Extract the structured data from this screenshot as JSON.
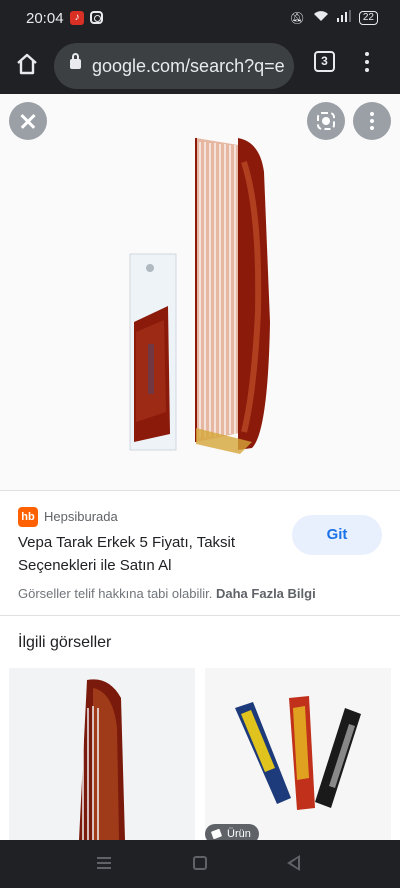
{
  "status_bar": {
    "time": "20:04",
    "battery": "22"
  },
  "browser": {
    "url": "google.com/search?q=e",
    "tab_count": "3"
  },
  "viewer": {
    "source_logo_text": "hb",
    "source_name": "Hepsiburada",
    "title": "Vepa Tarak Erkek 5 Fiyatı, Taksit Seçenekleri ile Satın Al",
    "visit_button": "Git",
    "copyright_text": "Görseller telif hakkına tabi olabilir.",
    "more_info_link": "Daha Fazla Bilgi"
  },
  "related": {
    "heading": "İlgili görseller",
    "product_badge": "Ürün"
  },
  "colors": {
    "accent": "#1a73e8",
    "source_brand": "#ff6000",
    "comb_tortoise": "#8b1a0a"
  }
}
